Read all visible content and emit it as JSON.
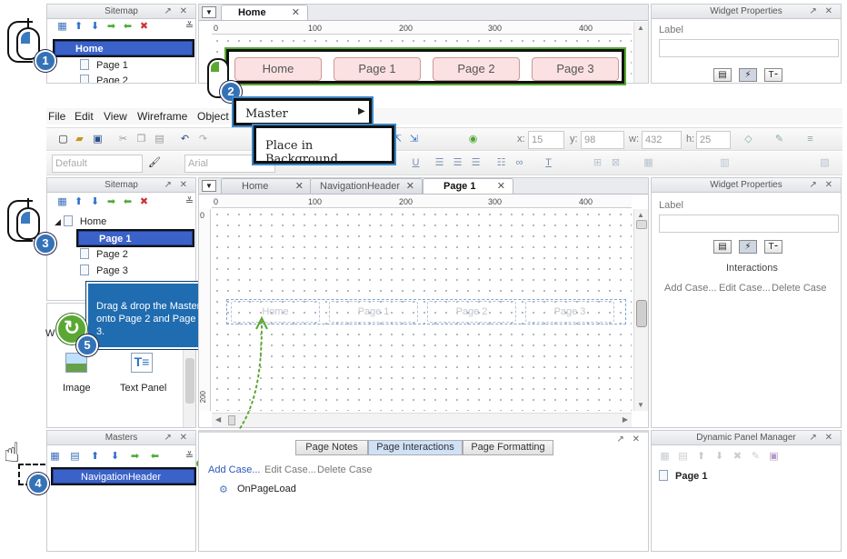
{
  "step1": {
    "sitemap_title": "Sitemap",
    "home_tab": "Home",
    "items": [
      "Home",
      "Page 1",
      "Page 2"
    ],
    "ruler": [
      "100",
      "200",
      "300",
      "400"
    ],
    "menu_buttons": [
      "Home",
      "Page 1",
      "Page 2",
      "Page 3"
    ],
    "widget_properties_title": "Widget Properties",
    "label_caption": "Label"
  },
  "context_menu": {
    "item1": "Master",
    "item2": "Place in Background"
  },
  "menubar": [
    "File",
    "Edit",
    "View",
    "Wireframe",
    "Object"
  ],
  "toolbar": {
    "font_style": "Default",
    "font_family": "Arial",
    "x_label": "x:",
    "x_value": "15",
    "y_label": "y:",
    "y_value": "98",
    "w_label": "w:",
    "w_value": "432",
    "h_label": "h:",
    "h_value": "25"
  },
  "sitemap": {
    "title": "Sitemap",
    "items": [
      "Home",
      "Page 1",
      "Page 2",
      "Page 3"
    ]
  },
  "tabs": [
    "Home",
    "NavigationHeader",
    "Page 1"
  ],
  "canvas": {
    "ruler": [
      "100",
      "200",
      "300",
      "400"
    ],
    "vruler": [
      "200"
    ],
    "ghost_buttons": [
      "Home",
      "Page 1",
      "Page 2",
      "Page 3"
    ]
  },
  "callout": "Drag & drop the Master onto Page 2 and Page 3.",
  "widgets": {
    "title_fragment": "W",
    "image_label": "Image",
    "text_panel_label": "Text Panel"
  },
  "widget_properties": {
    "title": "Widget Properties",
    "label_caption": "Label",
    "interactions": "Interactions",
    "add_case": "Add Case...",
    "edit_case": "Edit Case...",
    "delete_case": "Delete Case"
  },
  "masters": {
    "title": "Masters",
    "item": "NavigationHeader"
  },
  "page_panel": {
    "tabs": [
      "Page Notes",
      "Page Interactions",
      "Page Formatting"
    ],
    "add_case": "Add Case...",
    "edit_case": "Edit Case...",
    "delete_case": "Delete Case",
    "event": "OnPageLoad"
  },
  "dynamic_panel_manager": {
    "title": "Dynamic Panel Manager",
    "item": "Page 1"
  },
  "badges": [
    "1",
    "2",
    "3",
    "4",
    "5"
  ],
  "colors": {
    "accent_blue": "#3b62c9",
    "callout_blue": "#1f6cb0",
    "badge_blue": "#3472b8",
    "step_green": "#5aa832",
    "pink_button": "#fbe1e1"
  },
  "icons": {
    "mouse": "mouse-icon",
    "hand": "hand-cursor-icon",
    "refresh": "refresh-icon",
    "page": "page-icon",
    "image": "image-icon",
    "text": "text-panel-icon"
  }
}
